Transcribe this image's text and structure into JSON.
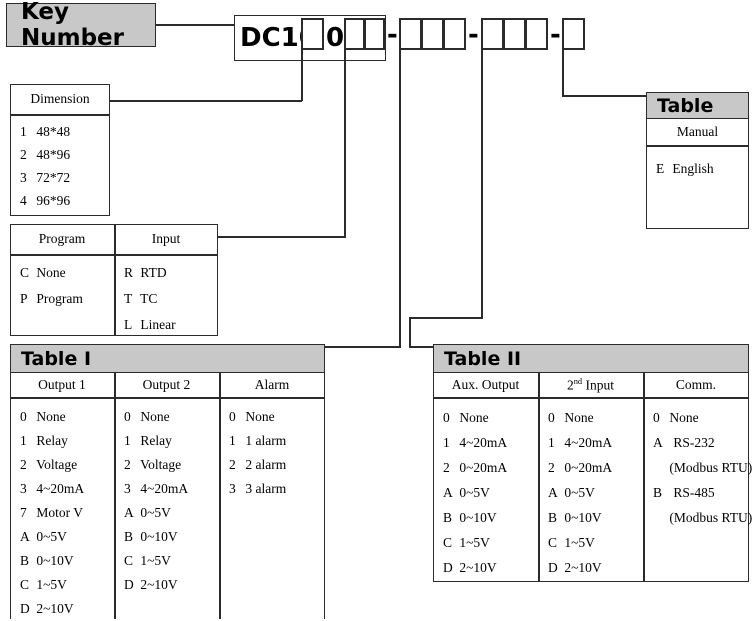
{
  "key_number": {
    "title": "Key Number",
    "prefix": "DC10",
    "fixed_digit": "0",
    "separator": "-",
    "groups": [
      {
        "name": "dimension-slot",
        "cells": 1
      },
      {
        "name": "program-input-slot",
        "cells": 2
      },
      {
        "name": "table1-slot",
        "cells": 3
      },
      {
        "name": "table2-slot",
        "cells": 3
      },
      {
        "name": "manual-slot",
        "cells": 1
      }
    ]
  },
  "dimension": {
    "header": "Dimension",
    "rows": [
      {
        "code": "1",
        "label": "48*48"
      },
      {
        "code": "2",
        "label": "48*96"
      },
      {
        "code": "3",
        "label": "72*72"
      },
      {
        "code": "4",
        "label": "96*96"
      }
    ]
  },
  "program_input": {
    "columns": [
      {
        "header": "Program",
        "rows": [
          {
            "code": "C",
            "label": "None"
          },
          {
            "code": "P",
            "label": "Program"
          }
        ]
      },
      {
        "header": "Input",
        "rows": [
          {
            "code": "R",
            "label": "RTD"
          },
          {
            "code": "T",
            "label": "TC"
          },
          {
            "code": "L",
            "label": "Linear"
          }
        ]
      }
    ]
  },
  "table_manual": {
    "title": "Table",
    "header": "Manual",
    "rows": [
      {
        "code": "E",
        "label": "English"
      }
    ]
  },
  "table_one": {
    "title": "Table I",
    "columns": [
      {
        "header": "Output 1",
        "rows": [
          {
            "code": "0",
            "label": "None"
          },
          {
            "code": "1",
            "label": "Relay"
          },
          {
            "code": "2",
            "label": "Voltage"
          },
          {
            "code": "3",
            "label": "4~20mA"
          },
          {
            "code": "7",
            "label": "Motor V"
          },
          {
            "code": "A",
            "label": "0~5V"
          },
          {
            "code": "B",
            "label": "0~10V"
          },
          {
            "code": "C",
            "label": "1~5V"
          },
          {
            "code": "D",
            "label": "2~10V"
          }
        ]
      },
      {
        "header": "Output 2",
        "rows": [
          {
            "code": "0",
            "label": "None"
          },
          {
            "code": "1",
            "label": "Relay"
          },
          {
            "code": "2",
            "label": "Voltage"
          },
          {
            "code": "3",
            "label": "4~20mA"
          },
          {
            "code": "A",
            "label": "0~5V"
          },
          {
            "code": "B",
            "label": "0~10V"
          },
          {
            "code": "C",
            "label": "1~5V"
          },
          {
            "code": "D",
            "label": "2~10V"
          }
        ]
      },
      {
        "header": "Alarm",
        "rows": [
          {
            "code": "0",
            "label": "None"
          },
          {
            "code": "1",
            "label": "1 alarm"
          },
          {
            "code": "2",
            "label": "2 alarm"
          },
          {
            "code": "3",
            "label": "3 alarm"
          }
        ]
      }
    ]
  },
  "table_two": {
    "title": "Table II",
    "columns": [
      {
        "header": "Aux. Output",
        "header_html": "Aux. Output",
        "rows": [
          {
            "code": "0",
            "label": "None"
          },
          {
            "code": "1",
            "label": "4~20mA"
          },
          {
            "code": "2",
            "label": "0~20mA"
          },
          {
            "code": "A",
            "label": "0~5V"
          },
          {
            "code": "B",
            "label": "0~10V"
          },
          {
            "code": "C",
            "label": "1~5V"
          },
          {
            "code": "D",
            "label": "2~10V"
          }
        ]
      },
      {
        "header": "2nd Input",
        "header_html": "2<sup>nd</sup> Input",
        "rows": [
          {
            "code": "0",
            "label": "None"
          },
          {
            "code": "1",
            "label": "4~20mA"
          },
          {
            "code": "2",
            "label": "0~20mA"
          },
          {
            "code": "A",
            "label": "0~5V"
          },
          {
            "code": "B",
            "label": "0~10V"
          },
          {
            "code": "C",
            "label": "1~5V"
          },
          {
            "code": "D",
            "label": "2~10V"
          }
        ]
      },
      {
        "header": "Comm.",
        "header_html": "Comm.",
        "rows": [
          {
            "code": "0",
            "label": "None"
          },
          {
            "code": "A",
            "label": "RS-232"
          },
          {
            "code": "",
            "label": "(Modbus RTU)"
          },
          {
            "code": "B",
            "label": "RS-485"
          },
          {
            "code": "",
            "label": "(Modbus RTU)"
          }
        ]
      }
    ]
  },
  "colors": {
    "header_gray": "#c8c8c8",
    "line": "#2b2b2b",
    "background": "#ffffff"
  }
}
